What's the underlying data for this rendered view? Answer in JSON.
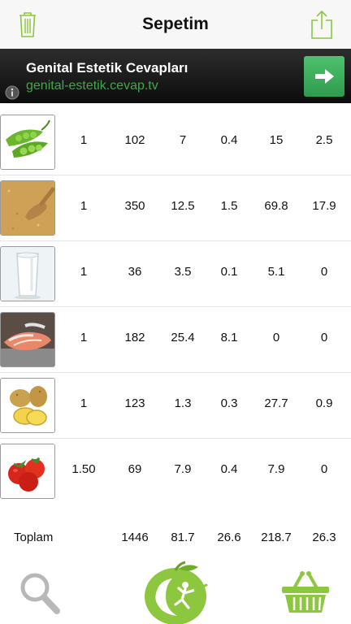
{
  "header": {
    "title": "Sepetim",
    "left_icon": "trash-icon",
    "right_icon": "share-icon",
    "accent_color": "#8dc63f"
  },
  "ad": {
    "title": "Genital Estetik Cevapları",
    "url": "genital-estetik.cevap.tv",
    "arrow_icon": "arrow-right-icon",
    "info_icon": "info-icon"
  },
  "items": [
    {
      "name": "peas-image",
      "values": [
        "1",
        "102",
        "7",
        "0.4",
        "15",
        "2.5"
      ]
    },
    {
      "name": "bulgur-image",
      "values": [
        "1",
        "350",
        "12.5",
        "1.5",
        "69.8",
        "17.9"
      ]
    },
    {
      "name": "milk-glass-image",
      "values": [
        "1",
        "36",
        "3.5",
        "0.1",
        "5.1",
        "0"
      ]
    },
    {
      "name": "salmon-image",
      "values": [
        "1",
        "182",
        "25.4",
        "8.1",
        "0",
        "0"
      ]
    },
    {
      "name": "potato-image",
      "values": [
        "1",
        "123",
        "1.3",
        "0.3",
        "27.7",
        "0.9"
      ]
    },
    {
      "name": "tomato-image",
      "values": [
        "1.50",
        "69",
        "7.9",
        "0.4",
        "7.9",
        "0"
      ]
    }
  ],
  "total": {
    "label": "Toplam",
    "values": [
      "1446",
      "81.7",
      "26.6",
      "218.7",
      "26.3"
    ]
  },
  "tabbar": {
    "search_icon": "search-icon",
    "center_icon": "apple-logo-icon",
    "basket_icon": "basket-icon"
  }
}
